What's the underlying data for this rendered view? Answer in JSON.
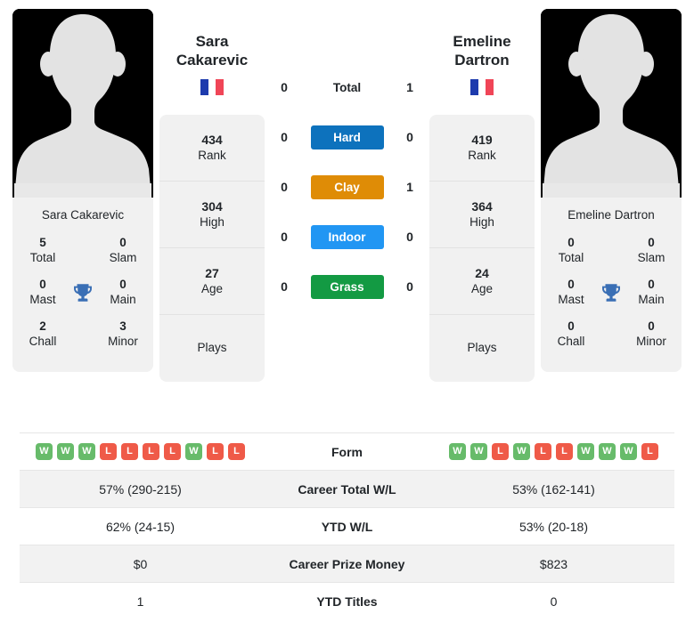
{
  "colors": {
    "hard": "#0d72bd",
    "clay": "#df8c06",
    "indoor": "#2196f3",
    "grass": "#139a43",
    "win_badge": "#67bb6a",
    "loss_badge": "#ef5a48",
    "trophy": "#3a6fb5",
    "card_bg": "#f1f1f1"
  },
  "players": {
    "left": {
      "name": "Sara Cakarevic",
      "name_line1": "Sara",
      "name_line2": "Cakarevic",
      "photo_caption": "Sara Cakarevic",
      "flag": "france-flag-icon",
      "titles": [
        {
          "value": "5",
          "label": "Total"
        },
        {
          "value": "0",
          "label": "Slam"
        },
        {
          "value": "0",
          "label": "Mast"
        },
        {
          "value": "0",
          "label": "Main"
        },
        {
          "value": "2",
          "label": "Chall"
        },
        {
          "value": "3",
          "label": "Minor"
        }
      ],
      "stats": [
        {
          "value": "434",
          "label": "Rank"
        },
        {
          "value": "304",
          "label": "High"
        },
        {
          "value": "27",
          "label": "Age"
        },
        {
          "value": "",
          "label": "Plays"
        }
      ],
      "h2h": {
        "total": "0",
        "hard": "0",
        "clay": "0",
        "indoor": "0",
        "grass": "0"
      },
      "form": [
        "W",
        "W",
        "W",
        "L",
        "L",
        "L",
        "L",
        "W",
        "L",
        "L"
      ],
      "career_total_wl": "57% (290-215)",
      "ytd_wl": "62% (24-15)",
      "career_prize_money": "$0",
      "ytd_titles": "1"
    },
    "right": {
      "name": "Emeline Dartron",
      "name_line1": "Emeline",
      "name_line2": "Dartron",
      "photo_caption": "Emeline Dartron",
      "flag": "france-flag-icon",
      "titles": [
        {
          "value": "0",
          "label": "Total"
        },
        {
          "value": "0",
          "label": "Slam"
        },
        {
          "value": "0",
          "label": "Mast"
        },
        {
          "value": "0",
          "label": "Main"
        },
        {
          "value": "0",
          "label": "Chall"
        },
        {
          "value": "0",
          "label": "Minor"
        }
      ],
      "stats": [
        {
          "value": "419",
          "label": "Rank"
        },
        {
          "value": "364",
          "label": "High"
        },
        {
          "value": "24",
          "label": "Age"
        },
        {
          "value": "",
          "label": "Plays"
        }
      ],
      "h2h": {
        "total": "1",
        "hard": "0",
        "clay": "1",
        "indoor": "0",
        "grass": "0"
      },
      "form": [
        "W",
        "W",
        "L",
        "W",
        "L",
        "L",
        "W",
        "W",
        "W",
        "L"
      ],
      "career_total_wl": "53% (162-141)",
      "ytd_wl": "53% (20-18)",
      "career_prize_money": "$823",
      "ytd_titles": "0"
    }
  },
  "surfaces": [
    {
      "key": "total",
      "label": "Total",
      "style": "plain"
    },
    {
      "key": "hard",
      "label": "Hard",
      "style": "hard"
    },
    {
      "key": "clay",
      "label": "Clay",
      "style": "clay"
    },
    {
      "key": "indoor",
      "label": "Indoor",
      "style": "indoor"
    },
    {
      "key": "grass",
      "label": "Grass",
      "style": "grass"
    }
  ],
  "table": {
    "rows": [
      {
        "label": "Form",
        "type": "form"
      },
      {
        "label": "Career Total W/L",
        "type": "text",
        "left": "57% (290-215)",
        "right": "53% (162-141)"
      },
      {
        "label": "YTD W/L",
        "type": "text",
        "left": "62% (24-15)",
        "right": "53% (20-18)"
      },
      {
        "label": "Career Prize Money",
        "type": "text",
        "left": "$0",
        "right": "$823"
      },
      {
        "label": "YTD Titles",
        "type": "text",
        "left": "1",
        "right": "0"
      }
    ]
  }
}
